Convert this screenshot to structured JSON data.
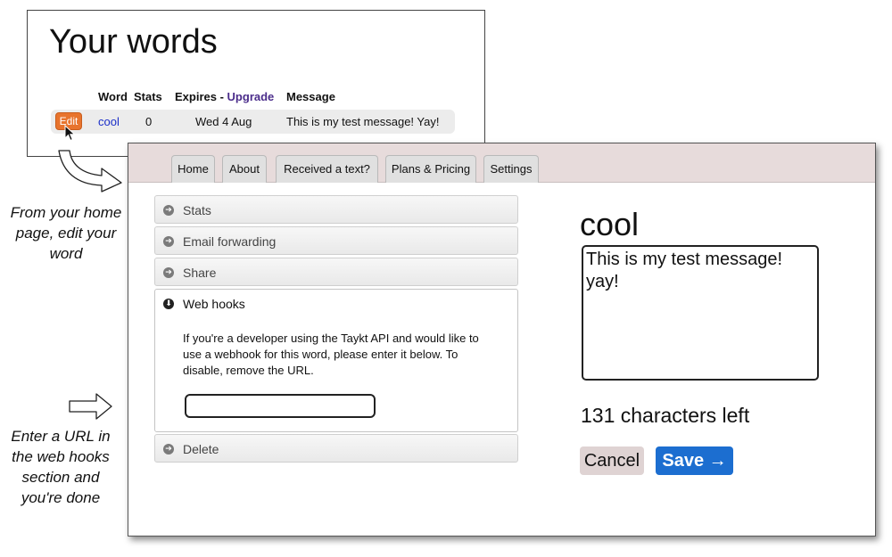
{
  "your_words": {
    "title": "Your words",
    "headers": {
      "word": "Word",
      "stats": "Stats",
      "expires": "Expires",
      "separator": " - ",
      "upgrade": "Upgrade",
      "message": "Message"
    },
    "row": {
      "edit": "Edit",
      "word": "cool",
      "stats": "0",
      "expires": "Wed 4 Aug",
      "message": "This is my test message! Yay!"
    }
  },
  "annotations": {
    "note1": "From your home page, edit your word",
    "note2": "Enter a URL in the web hooks section and you're done"
  },
  "nav": {
    "tabs": [
      "Home",
      "About",
      "Received a text?",
      "Plans & Pricing",
      "Settings"
    ]
  },
  "accordion": {
    "stats": "Stats",
    "email_forwarding": "Email forwarding",
    "share": "Share",
    "web_hooks": "Web hooks",
    "web_hooks_description": "If you're a developer using the Taykt API and would like to use a webhook for this word, please enter it below. To disable, remove the URL.",
    "webhook_url_value": "",
    "delete": "Delete"
  },
  "editor": {
    "word": "cool",
    "message": "This is my test message!\nyay!",
    "chars_left": "131 characters left",
    "cancel": "Cancel",
    "save": "Save →"
  },
  "colors": {
    "edit_button": "#e8742d",
    "save_button": "#1c6ed0",
    "cancel_button": "#dfd3d3",
    "tab_bar": "#e7dbdb",
    "upgrade_link": "#4b2d8b",
    "word_link": "#1a2ec8"
  },
  "icons": {
    "collapsed": "arrow-right-circle-icon",
    "expanded": "arrow-down-circle-icon",
    "pointer": "mouse-pointer-icon"
  }
}
